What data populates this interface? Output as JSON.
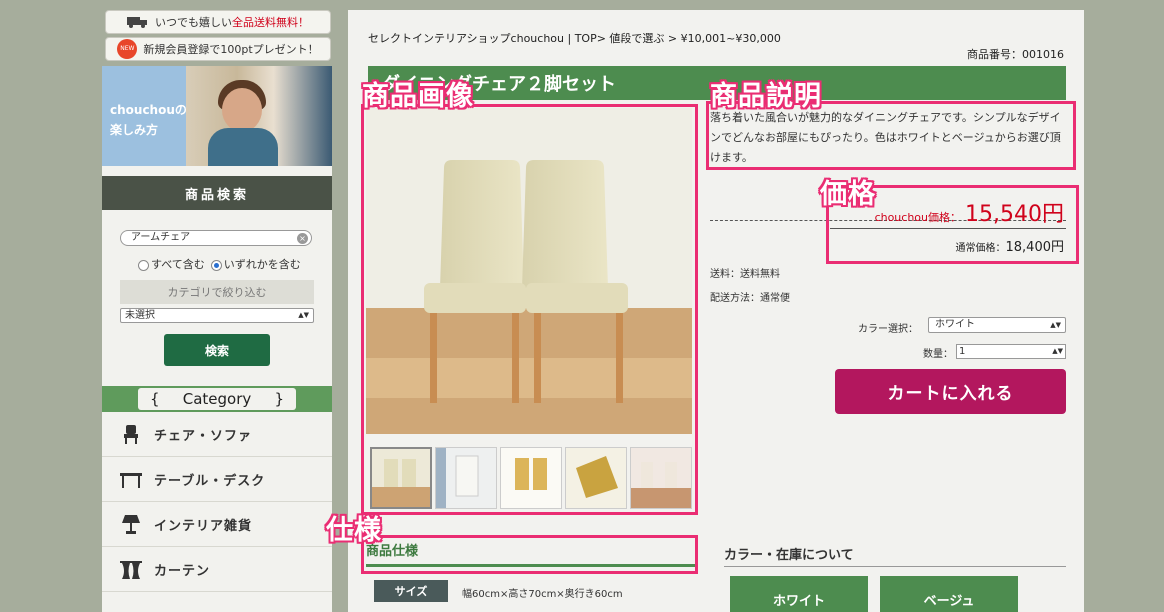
{
  "top_buttons": [
    {
      "prefix": "いつでも嬉しい",
      "emphasis": "全品送料無料！"
    },
    {
      "badge": "NEW",
      "text": "新規会員登録で100ptプレゼント！"
    }
  ],
  "banner": {
    "text_line1": "chouchouの",
    "text_line2": "楽しみ方"
  },
  "search": {
    "heading": "商品検索",
    "input_value": "アームチェア",
    "radio_all": "すべて含む",
    "radio_any": "いずれかを含む",
    "category_narrow": "カテゴリで絞り込む",
    "category_select": "未選択",
    "button": "検索"
  },
  "category": {
    "brace_open": "{",
    "title": "Category",
    "brace_close": "}",
    "items": [
      {
        "label": "チェア・ソファ",
        "icon": "chair-icon"
      },
      {
        "label": "テーブル・デスク",
        "icon": "table-icon"
      },
      {
        "label": "インテリア雑貨",
        "icon": "lamp-icon"
      },
      {
        "label": "カーテン",
        "icon": "curtain-icon"
      }
    ]
  },
  "main": {
    "breadcrumb": "セレクトインテリアショップchouchou | TOP> 値段で選ぶ > ¥10,001~¥30,000",
    "product_no": "商品番号：001016",
    "title": "ダイニングチェア２脚セット",
    "description": "落ち着いた風合いが魅力的なダイニングチェアです。シンプルなデザインでどんなお部屋にもぴったり。色はホワイトとベージュからお選び頂けます。",
    "price_label": "chouchou価格：",
    "price": "15,540円",
    "regular_label": "通常価格：",
    "regular_price": "18,400円",
    "shipping_fee": "送料：送料無料",
    "shipping_method": "配送方法：通常便",
    "color_label": "カラー選択：",
    "color_value": "ホワイト",
    "qty_label": "数量：",
    "qty_value": "1",
    "cart_button": "カートに入れる",
    "spec_heading": "商品仕様",
    "spec_size_label": "サイズ",
    "spec_size_value": "幅60cm×高さ70cm×奥行き60cm",
    "color_stock_heading": "カラー・在庫について",
    "color_options": [
      "ホワイト",
      "ベージュ"
    ]
  },
  "annotations": {
    "image": "商品画像",
    "description": "商品説明",
    "price": "価格",
    "spec": "仕様"
  },
  "colors": {
    "accent_pink": "#ea2d73",
    "green": "#4d8c4f",
    "cart": "#b3175e",
    "price_red": "#d0021b"
  }
}
